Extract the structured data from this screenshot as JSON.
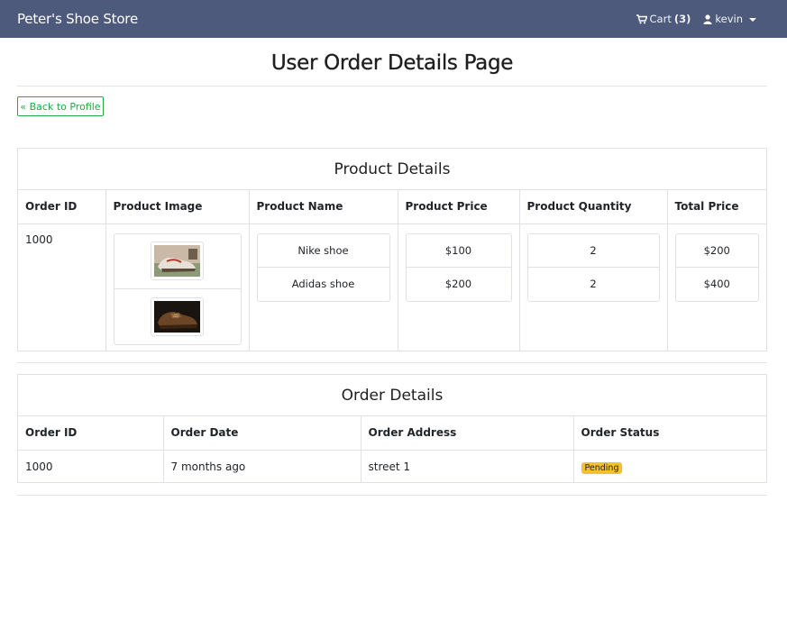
{
  "navbar": {
    "brand": "Peter's Shoe Store",
    "cart_label": "Cart",
    "cart_count": "(3)",
    "user_label": "kevin"
  },
  "page": {
    "title": "User Order Details Page",
    "back_button": "« Back to Profile"
  },
  "product_details": {
    "heading": "Product Details",
    "columns": [
      "Order ID",
      "Product Image",
      "Product Name",
      "Product Price",
      "Product Quantity",
      "Total Price"
    ],
    "order_id": "1000",
    "items": [
      {
        "name": "Nike shoe",
        "price": "$100",
        "quantity": "2",
        "total": "$200"
      },
      {
        "name": "Adidas shoe",
        "price": "$200",
        "quantity": "2",
        "total": "$400"
      }
    ]
  },
  "order_details": {
    "heading": "Order Details",
    "columns": [
      "Order ID",
      "Order Date",
      "Order Address",
      "Order Status"
    ],
    "row": {
      "order_id": "1000",
      "date": "7 months ago",
      "address": "street 1",
      "status": "Pending"
    }
  },
  "colors": {
    "navbar": "#4d5a7c",
    "back_button": "#28a745",
    "status_pending": "#f2c12e"
  },
  "icons": {
    "cart": "shopping-cart-icon",
    "user": "user-icon",
    "dropdown": "caret-down-icon"
  }
}
